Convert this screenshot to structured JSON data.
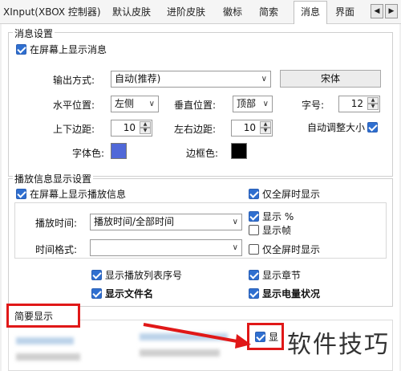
{
  "tabs": [
    {
      "label": "XInput(XBOX 控制器)"
    },
    {
      "label": "默认皮肤"
    },
    {
      "label": "进阶皮肤"
    },
    {
      "label": "徽标"
    },
    {
      "label": "简索"
    },
    {
      "label": "消息"
    },
    {
      "label": "界面"
    }
  ],
  "tab_arrows": {
    "left": "◀",
    "right": "▶"
  },
  "message_settings": {
    "title": "消息设置",
    "show_on_screen": {
      "label": "在屏幕上显示消息",
      "checked": true
    },
    "output_mode_label": "输出方式:",
    "output_mode_value": "自动(推荐)",
    "font_button": "宋体",
    "h_pos_label": "水平位置:",
    "h_pos_value": "左侧",
    "v_pos_label": "垂直位置:",
    "v_pos_value": "顶部",
    "font_size_label": "字号:",
    "font_size_value": "12",
    "vmargin_label": "上下边距:",
    "vmargin_value": "10",
    "hmargin_label": "左右边距:",
    "hmargin_value": "10",
    "auto_size": {
      "label": "自动调整大小",
      "checked": true
    },
    "font_color_label": "字体色:",
    "font_color": "#5068d8",
    "border_color_label": "边框色:",
    "border_color": "#000000"
  },
  "playback_settings": {
    "title": "播放信息显示设置",
    "show_playback": {
      "label": "在屏幕上显示播放信息",
      "checked": true
    },
    "fullscreen_only_1": {
      "label": "仅全屏时显示",
      "checked": true
    },
    "play_time_label": "播放时间:",
    "play_time_value": "播放时间/全部时间",
    "show_percent": {
      "label": "显示 %",
      "checked": true
    },
    "show_frames": {
      "label": "显示帧",
      "checked": false
    },
    "time_format_label": "时间格式:",
    "time_format_value": "",
    "fullscreen_only_2": {
      "label": "仅全屏时显示",
      "checked": false
    },
    "show_playlist_index": {
      "label": "显示播放列表序号",
      "checked": true
    },
    "show_chapter": {
      "label": "显示章节",
      "checked": true
    },
    "show_filename": {
      "label": "显示文件名",
      "checked": true
    },
    "show_battery": {
      "label": "显示电量状况",
      "checked": true
    }
  },
  "summary": {
    "title": "简要显示",
    "check_label_fragment": "显"
  },
  "watermark_text": "软件技巧",
  "dropdown_glyph": "∨",
  "spin_glyphs": {
    "up": "▲",
    "down": "▼"
  }
}
